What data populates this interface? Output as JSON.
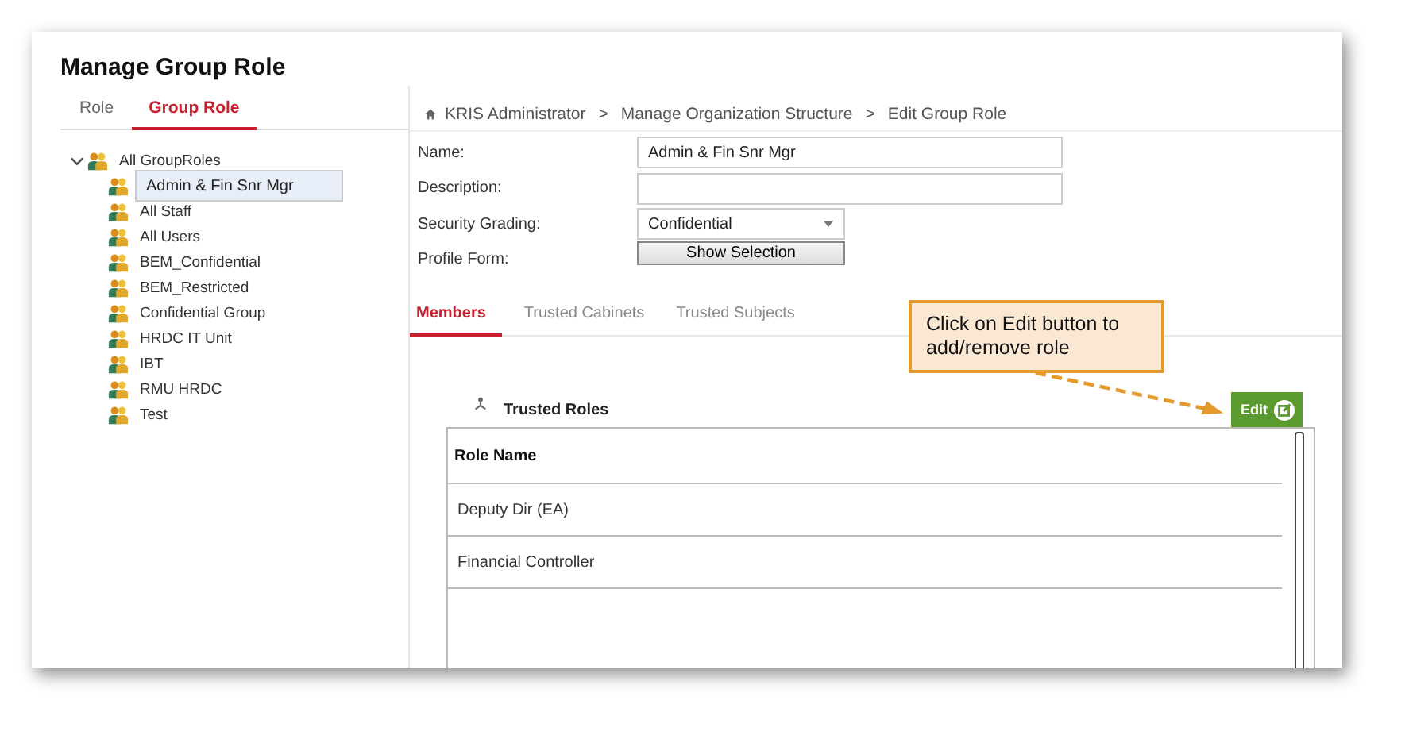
{
  "page": {
    "title": "Manage Group Role"
  },
  "tabs": [
    {
      "label": "Role",
      "selected": false
    },
    {
      "label": "Group Role",
      "selected": true
    }
  ],
  "tree": {
    "label": "All GroupRoles",
    "expanded": true,
    "children": [
      {
        "label": "Admin & Fin Snr Mgr",
        "selected": true
      },
      {
        "label": "All Staff",
        "selected": false
      },
      {
        "label": "All Users",
        "selected": false
      },
      {
        "label": "BEM_Confidential",
        "selected": false
      },
      {
        "label": "BEM_Restricted",
        "selected": false
      },
      {
        "label": "Confidential Group",
        "selected": false
      },
      {
        "label": "HRDC IT Unit",
        "selected": false
      },
      {
        "label": "IBT",
        "selected": false
      },
      {
        "label": "RMU HRDC",
        "selected": false
      },
      {
        "label": "Test",
        "selected": false
      }
    ]
  },
  "breadcrumb": {
    "separator": ">",
    "items": [
      "KRIS Administrator",
      "Manage Organization Structure",
      "Edit Group Role"
    ]
  },
  "form": [
    {
      "kind": "text",
      "label": "Name:",
      "value": "Admin & Fin Snr Mgr"
    },
    {
      "kind": "text",
      "label": "Description:"
    },
    {
      "kind": "select",
      "label": "Security Grading:",
      "value": "Confidential"
    },
    {
      "kind": "button",
      "label": "Profile Form:",
      "value": "Show Selection"
    }
  ],
  "detail_tabs": [
    {
      "label": "Members",
      "selected": true
    },
    {
      "label": "Trusted Cabinets",
      "selected": false
    },
    {
      "label": "Trusted Subjects",
      "selected": false
    }
  ],
  "trusted_roles": {
    "title": "Trusted Roles",
    "edit_button": "Edit",
    "columns": [
      "Role Name"
    ],
    "rows": [
      "Deputy Dir (EA)",
      "Financial Controller"
    ]
  },
  "callout": {
    "text": "Click on Edit button to add/remove role"
  }
}
